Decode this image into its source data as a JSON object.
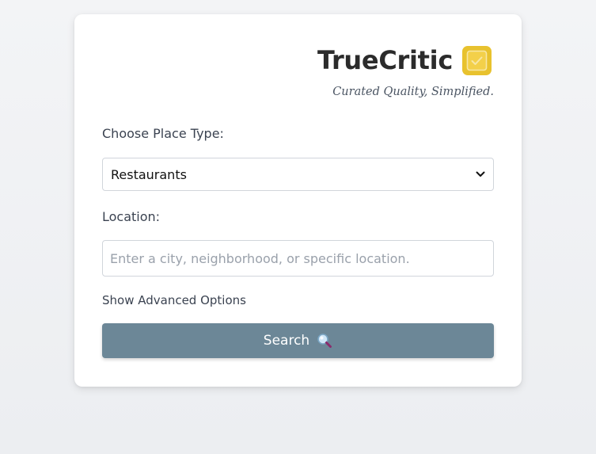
{
  "brand": {
    "name": "TrueCritic",
    "tagline": "Curated Quality, Simplified.",
    "logo_icon": "check-square-icon",
    "logo_color": "#e8c22e"
  },
  "form": {
    "place_type_label": "Choose Place Type:",
    "place_type_value": "Restaurants",
    "location_label": "Location:",
    "location_placeholder": "Enter a city, neighborhood, or specific location.",
    "location_value": "",
    "advanced_label": "Show Advanced Options",
    "search_label": "Search",
    "search_icon": "magnifier-icon",
    "button_color": "#6c8797"
  }
}
